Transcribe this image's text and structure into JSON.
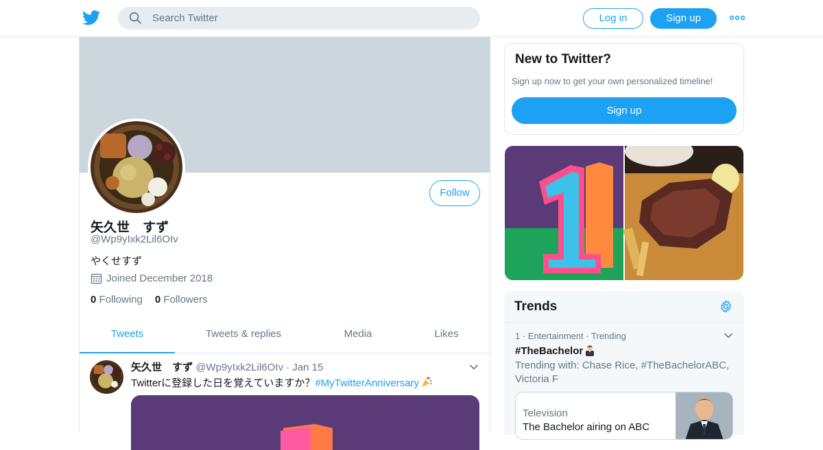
{
  "header": {
    "search_placeholder": "Search Twitter",
    "login_label": "Log in",
    "signup_label": "Sign up",
    "logo_icon": "twitter-bird-icon",
    "more_icon": "more-dots-icon",
    "brand_color": "#1da1f2"
  },
  "profile": {
    "display_name": "矢久世　すず",
    "handle": "@Wp9yIxk2Lil6OIv",
    "bio": "やくせすず",
    "joined": "Joined December 2018",
    "following_count": "0",
    "following_label": "Following",
    "followers_count": "0",
    "followers_label": "Followers",
    "follow_label": "Follow"
  },
  "tabs": [
    {
      "label": "Tweets",
      "active": true
    },
    {
      "label": "Tweets & replies",
      "active": false
    },
    {
      "label": "Media",
      "active": false
    },
    {
      "label": "Likes",
      "active": false
    }
  ],
  "tweet": {
    "name": "矢久世　すず",
    "handle": "@Wp9yIxk2Lil6OIv",
    "separator": "·",
    "date": "Jan 15",
    "text_prefix": "Twitterに登録した日を覚えていますか？",
    "hashtag": "#MyTwitterAnniversary"
  },
  "signup_card": {
    "title": "New to Twitter?",
    "subtitle": "Sign up now to get your own personalized timeline!",
    "button_label": "Sign up"
  },
  "trends": {
    "title": "Trends",
    "items": [
      {
        "meta": "1 · Entertainment · Trending",
        "name": "#TheBachelor",
        "trending_with": "Trending with: Chase Rice, #TheBachelorABC, Victoria F"
      }
    ],
    "tv_card": {
      "category": "Television",
      "title": "The Bachelor airing on ABC"
    }
  }
}
